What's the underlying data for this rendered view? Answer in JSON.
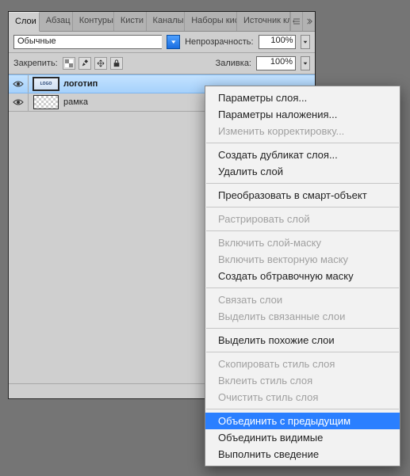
{
  "tabs": [
    "Слои",
    "Абзац",
    "Контуры",
    "Кисти",
    "Каналы",
    "Наборы кис",
    "Источник кл"
  ],
  "active_tab_index": 0,
  "blend_mode": "Обычные",
  "opacity_label": "Непрозрачность:",
  "opacity_value": "100%",
  "lock_label": "Закрепить:",
  "fill_label": "Заливка:",
  "fill_value": "100%",
  "layers": [
    {
      "name": "логотип",
      "visible": true,
      "selected": true,
      "thumb": "logo"
    },
    {
      "name": "рамка",
      "visible": true,
      "selected": false,
      "thumb": "transparent"
    }
  ],
  "context_menu": {
    "groups": [
      [
        {
          "label": "Параметры слоя...",
          "enabled": true
        },
        {
          "label": "Параметры наложения...",
          "enabled": true
        },
        {
          "label": "Изменить корректировку...",
          "enabled": false
        }
      ],
      [
        {
          "label": "Создать дубликат слоя...",
          "enabled": true
        },
        {
          "label": "Удалить слой",
          "enabled": true
        }
      ],
      [
        {
          "label": "Преобразовать в смарт-объект",
          "enabled": true
        }
      ],
      [
        {
          "label": "Растрировать слой",
          "enabled": false
        }
      ],
      [
        {
          "label": "Включить слой-маску",
          "enabled": false
        },
        {
          "label": "Включить векторную маску",
          "enabled": false
        },
        {
          "label": "Создать обтравочную маску",
          "enabled": true
        }
      ],
      [
        {
          "label": "Связать слои",
          "enabled": false
        },
        {
          "label": "Выделить связанные слои",
          "enabled": false
        }
      ],
      [
        {
          "label": "Выделить похожие слои",
          "enabled": true
        }
      ],
      [
        {
          "label": "Скопировать стиль слоя",
          "enabled": false
        },
        {
          "label": "Вклеить стиль слоя",
          "enabled": false
        },
        {
          "label": "Очистить стиль слоя",
          "enabled": false
        }
      ],
      [
        {
          "label": "Объединить с предыдущим",
          "enabled": true,
          "highlight": true
        },
        {
          "label": "Объединить видимые",
          "enabled": true
        },
        {
          "label": "Выполнить сведение",
          "enabled": true
        }
      ]
    ]
  }
}
